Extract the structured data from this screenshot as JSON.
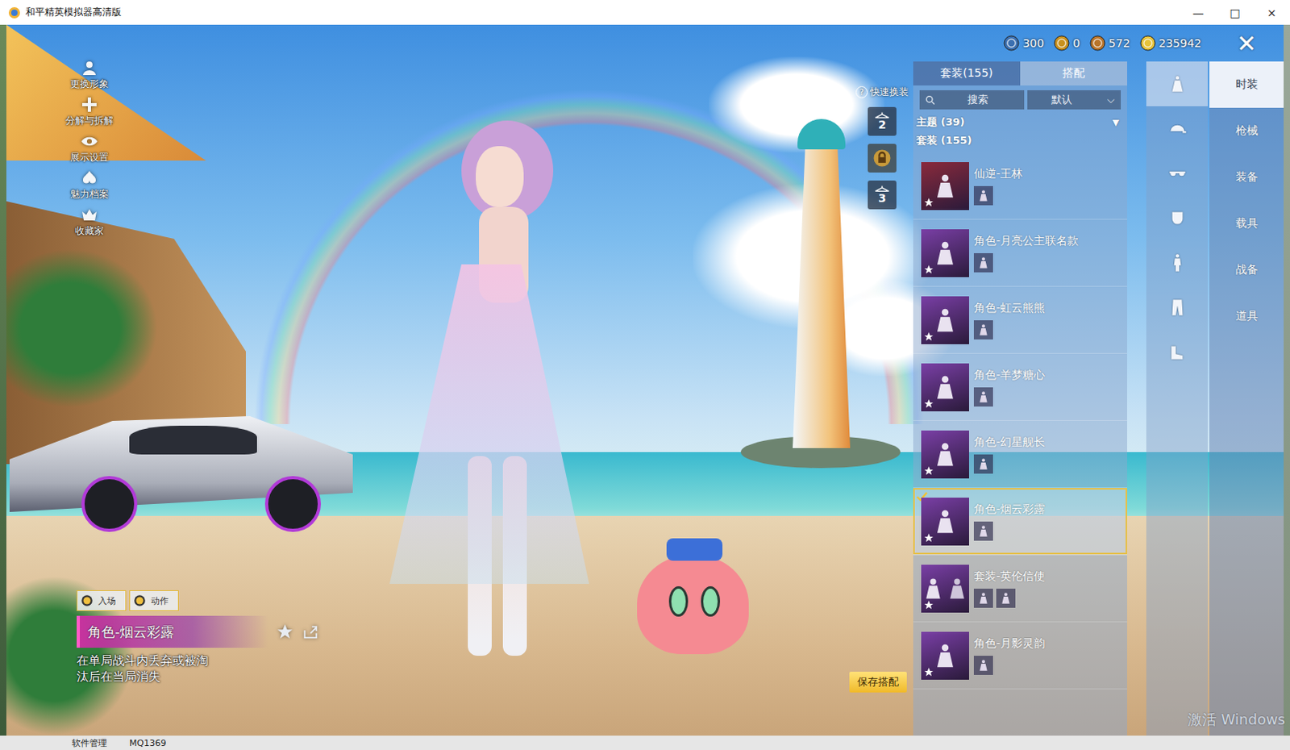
{
  "window": {
    "title": "和平精英模拟器高清版",
    "controls": [
      "—",
      "□",
      "×"
    ]
  },
  "currencies": [
    {
      "value": "300",
      "color": "#3b6fb0"
    },
    {
      "value": "0",
      "color": "#c8911e"
    },
    {
      "value": "572",
      "color": "#b8742a"
    },
    {
      "value": "235942",
      "color": "#e6c23a"
    }
  ],
  "close": "✕",
  "left_menu": [
    {
      "label": "更换形象"
    },
    {
      "label": "分解与拆解"
    },
    {
      "label": "展示设置"
    },
    {
      "label": "魅力档案"
    },
    {
      "label": "收藏家"
    }
  ],
  "quick_change": {
    "help": "?",
    "label": "快速换装",
    "slots": [
      {
        "label": "2",
        "locked": false
      },
      {
        "label": "",
        "locked": true
      },
      {
        "label": "3",
        "locked": false
      }
    ]
  },
  "panel": {
    "tabs": [
      {
        "label": "套装(155)",
        "selected": true
      },
      {
        "label": "搭配",
        "selected": false
      }
    ],
    "search": {
      "placeholder": "搜索"
    },
    "sort": {
      "value": "默认",
      "arrow": "⌵"
    },
    "theme_header": {
      "label": "主题 (39)",
      "arrow": "▼"
    },
    "suit_header": "套装 (155)",
    "items": [
      {
        "name": "仙逆-王林",
        "color": "#8a2a3c",
        "kind": "single",
        "selected": false,
        "equipped": false
      },
      {
        "name": "角色-月亮公主联名款",
        "color": "#7a3fa6",
        "kind": "single",
        "selected": false,
        "equipped": false
      },
      {
        "name": "角色-虹云熊熊",
        "color": "#7a3fa6",
        "kind": "single",
        "selected": false,
        "equipped": false
      },
      {
        "name": "角色-羊梦糖心",
        "color": "#7a3fa6",
        "kind": "single",
        "selected": false,
        "equipped": false
      },
      {
        "name": "角色-幻星舰长",
        "color": "#7a3fa6",
        "kind": "single",
        "selected": false,
        "equipped": false
      },
      {
        "name": "角色-烟云彩露",
        "color": "#7a3fa6",
        "kind": "single",
        "selected": true,
        "equipped": true
      },
      {
        "name": "套装-英伦信使",
        "color": "#7a3fa6",
        "kind": "pair",
        "selected": false,
        "equipped": false
      },
      {
        "name": "角色-月影灵韵",
        "color": "#7a3fa6",
        "kind": "single",
        "selected": false,
        "equipped": false
      }
    ]
  },
  "categories": [
    {
      "selected": true
    },
    {
      "selected": false
    },
    {
      "selected": false
    },
    {
      "selected": false
    },
    {
      "selected": false
    },
    {
      "selected": false
    },
    {
      "selected": false
    }
  ],
  "nav": [
    {
      "label": "时装",
      "selected": true
    },
    {
      "label": "枪械",
      "selected": false
    },
    {
      "label": "装备",
      "selected": false
    },
    {
      "label": "载具",
      "selected": false
    },
    {
      "label": "战备",
      "selected": false
    },
    {
      "label": "道具",
      "selected": false
    }
  ],
  "preview": {
    "modes": [
      {
        "label": "入场"
      },
      {
        "label": "动作"
      }
    ],
    "name": "角色-烟云彩露",
    "description": "在单局战斗内丢弃或被淘汰后在当局消失"
  },
  "save_button": "保存搭配",
  "taskbar": [
    "软件管理",
    "MQ1369"
  ],
  "watermark": "激活 Windows"
}
